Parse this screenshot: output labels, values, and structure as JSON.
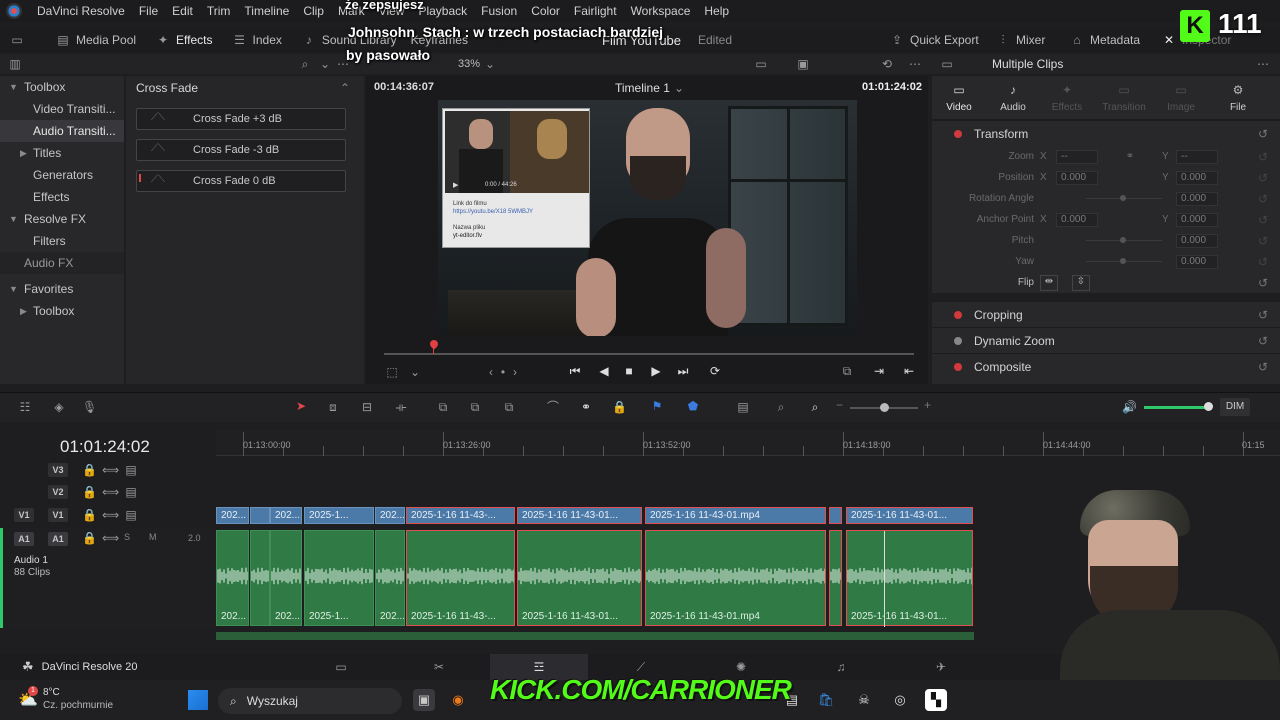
{
  "app": {
    "name": "DaVinci Resolve"
  },
  "menu": [
    "Trim",
    "Timeline",
    "Clip",
    "Mark",
    "View",
    "Playback",
    "Fusion",
    "Color",
    "Fairlight",
    "Workspace",
    "Help"
  ],
  "menu_first": "File",
  "menu_second": "Edit",
  "toolbar": {
    "media_pool": "Media Pool",
    "effects": "Effects",
    "index": "Index",
    "sound_library": "Sound Library",
    "keyframes": "Keyframes",
    "project_title": "Film YouTube",
    "edited": "Edited",
    "quick_export": "Quick Export",
    "mixer": "Mixer",
    "metadata": "Metadata",
    "inspector": "Inspector"
  },
  "overlay": {
    "chat_line1": "że zepsujesz",
    "chat_line2": "Johnsohn_Stach : w trzech postaciach bardziej",
    "chat_line3": "by pasowało",
    "viewers_count": "111",
    "kick_banner": "KICK.COM/CARRIONER"
  },
  "toolbox": {
    "items": [
      {
        "label": "Toolbox",
        "type": "header"
      },
      {
        "label": "Video Transiti...",
        "type": "child"
      },
      {
        "label": "Audio Transiti...",
        "type": "child-selected"
      },
      {
        "label": "Titles",
        "type": "collapsible"
      },
      {
        "label": "Generators",
        "type": "child"
      },
      {
        "label": "Effects",
        "type": "child"
      },
      {
        "label": "Resolve FX",
        "type": "header"
      },
      {
        "label": "Filters",
        "type": "child"
      },
      {
        "label": "Audio FX",
        "type": "header-dim"
      }
    ],
    "favorites": "Favorites",
    "favorites_toolbox": "Toolbox"
  },
  "effects_list": {
    "title": "Cross Fade",
    "items": [
      "Cross Fade +3 dB",
      "Cross Fade -3 dB",
      "Cross Fade 0 dB"
    ]
  },
  "viewer": {
    "zoom": "33%",
    "source_tc": "00:14:36:07",
    "timeline_name": "Timeline 1",
    "record_tc": "01:01:24:02",
    "pip_url": "https://youtu.be/X18 5WMBJY",
    "pip_link_label": "Link do filmu",
    "pip_name_label": "Nazwa pliku",
    "pip_file": "yt-editor.flv",
    "pip_time": "0:00 / 44:26"
  },
  "inspector": {
    "title": "Multiple Clips",
    "tabs": [
      "Video",
      "Audio",
      "Effects",
      "Transition",
      "Image",
      "File"
    ],
    "transform": "Transform",
    "zoom_label": "Zoom",
    "position_label": "Position",
    "rotation_label": "Rotation Angle",
    "anchor_label": "Anchor Point",
    "pitch_label": "Pitch",
    "yaw_label": "Yaw",
    "flip_label": "Flip",
    "zoom_x": "--",
    "zoom_y": "--",
    "pos_x": "0.000",
    "pos_y": "0.000",
    "rotation": "0.000",
    "anchor_x": "0.000",
    "anchor_y": "0.000",
    "pitch": "0.000",
    "yaw": "0.000",
    "axis_x": "X",
    "axis_y": "Y",
    "sections": [
      "Cropping",
      "Dynamic Zoom",
      "Composite"
    ]
  },
  "timeline": {
    "timecode": "01:01:24:02",
    "dim": "DIM",
    "ruler": [
      "01:13:00:00",
      "01:13:26:00",
      "01:13:52:00",
      "01:14:18:00",
      "01:14:44:00",
      "01:15"
    ],
    "tracks": {
      "v3": "V3",
      "v2": "V2",
      "v1": "V1",
      "a1": "A1"
    },
    "audio_track_name": "Audio 1",
    "audio_track_clips": "88 Clips",
    "audio_level": "2.0",
    "solo": "S",
    "mute": "M",
    "video_clips": [
      "202...",
      "",
      "202...",
      "2025-1...",
      "202...",
      "2025-1-16 11-43-...",
      "2025-1-16 11-43-01...",
      "2025-1-16 11-43-01.mp4",
      "",
      "2025-1-16 11-43-01..."
    ],
    "audio_clips": [
      "202...",
      "",
      "202...",
      "2025-1...",
      "202...",
      "2025-1-16 11-43-...",
      "2025-1-16 11-43-01...",
      "2025-1-16 11-43-01.mp4",
      "",
      "2025-1-16 11-43-01..."
    ]
  },
  "pagebar": {
    "app_version": "DaVinci Resolve 20"
  },
  "taskbar": {
    "temp": "8°C",
    "weather": "Cz. pochmurnie",
    "search_placeholder": "Wyszukaj",
    "weather_badge": "1"
  }
}
